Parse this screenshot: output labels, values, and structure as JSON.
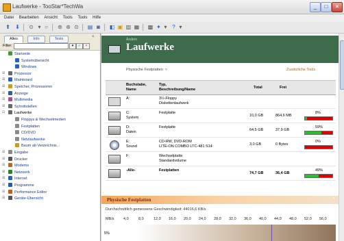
{
  "window": {
    "title": "Laufwerke - TooStar*TechWa",
    "controls": [
      "_",
      "□",
      "×"
    ]
  },
  "menu": [
    "Datei",
    "Bearbeiten",
    "Ansicht",
    "Tools",
    "Tools",
    "Hilfe"
  ],
  "left_panel": {
    "tabs": [
      "Alles",
      "Info",
      "Tests"
    ],
    "filter_label": "Filter:",
    "filter_value": "",
    "tree": [
      {
        "label": "Startseite",
        "level": 0
      },
      {
        "label": "Systemübersicht",
        "level": 1
      },
      {
        "label": "Windows",
        "level": 1
      },
      {
        "label": "Prozessor",
        "level": 0
      },
      {
        "label": "Mainboard",
        "level": 0
      },
      {
        "label": "Speicher, Prozessoren",
        "level": 0
      },
      {
        "label": "Anzeige",
        "level": 0
      },
      {
        "label": "Multimedia",
        "level": 0
      },
      {
        "label": "Schnittstellen",
        "level": 0
      },
      {
        "label": "Laufwerke",
        "level": 0
      },
      {
        "label": "Floppys & Wechselmedien",
        "level": 1
      },
      {
        "label": "Festplatten",
        "level": 1
      },
      {
        "label": "CD/DVD",
        "level": 1
      },
      {
        "label": "Netzlaufwerke",
        "level": 1
      },
      {
        "label": "Baum ab Verzeichnis...",
        "level": 1
      },
      {
        "label": "Eingabe",
        "level": 0
      },
      {
        "label": "Drucker",
        "level": 0
      },
      {
        "label": "Modems",
        "level": 0
      },
      {
        "label": "Netzwerk",
        "level": 0
      },
      {
        "label": "Internet",
        "level": 0
      },
      {
        "label": "Programme",
        "level": 0
      },
      {
        "label": "Performance Editor",
        "level": 0
      },
      {
        "label": "Geräte-Übersicht",
        "level": 0
      }
    ]
  },
  "content": {
    "breadcrumb": "Ändern",
    "title": "Laufwerke",
    "subheader": "Physische Festplatten",
    "extra_link": "Zusätzliche Tools",
    "table": {
      "headers": {
        "letter": [
          "Buchstabe,",
          "Name"
        ],
        "type": [
          "Typ,",
          "Beschreibung/Name"
        ],
        "total": "Total",
        "free": "Frei"
      },
      "rows": [
        {
          "letter": [
            "A:"
          ],
          "type": [
            "3½-Floppy",
            "Diskettenlaufwerk"
          ],
          "total": "",
          "free": "",
          "pct": "",
          "icon": "floppy"
        },
        {
          "letter": [
            "C:",
            "System"
          ],
          "type": [
            "Festplatte"
          ],
          "total": "10,0 GB",
          "free": "864,6 MB",
          "pct": "8%",
          "fill": 0.08,
          "icon": "hdd"
        },
        {
          "letter": [
            "D:",
            "Daten"
          ],
          "type": [
            "Festplatte"
          ],
          "total": "64,5 GB",
          "free": "37,9 GB",
          "pct": "59%",
          "fill": 0.59,
          "icon": "hdd"
        },
        {
          "letter": [
            "E:",
            "Sound"
          ],
          "type": [
            "CD-RW, DVD-ROM",
            "LITE-ON COMBO LTC-481 S14"
          ],
          "total": "3,0 GB",
          "free": "0 Bytes",
          "pct": "0%",
          "fill": 0.0,
          "icon": "cd"
        },
        {
          "letter": [
            "F:"
          ],
          "type": [
            "Wechselplatte",
            "Standardvolume"
          ],
          "total": "",
          "free": "",
          "pct": "",
          "icon": "hdd"
        },
        {
          "letter": [
            "-Alle-"
          ],
          "type": [
            "Festplatten"
          ],
          "total": "74,7 GB",
          "free": "36,4 GB",
          "pct": "49%",
          "fill": 0.49,
          "icon": "hdd",
          "total_row": true
        }
      ]
    },
    "section_title": "Physische Festplatten",
    "avg_speed": "Durchschnittlich gemessene Geschwindigkeit: 44016,6 KB/s",
    "axis_unit": "MB/s",
    "axis_ticks": [
      "4,0",
      "8,0",
      "12,0",
      "16,0",
      "20,0",
      "24,0",
      "28,0",
      "32,0",
      "36,0",
      "40,0",
      "44,0",
      "48,0",
      "52,0",
      "56,0"
    ],
    "chart_ylabel": "5%"
  }
}
